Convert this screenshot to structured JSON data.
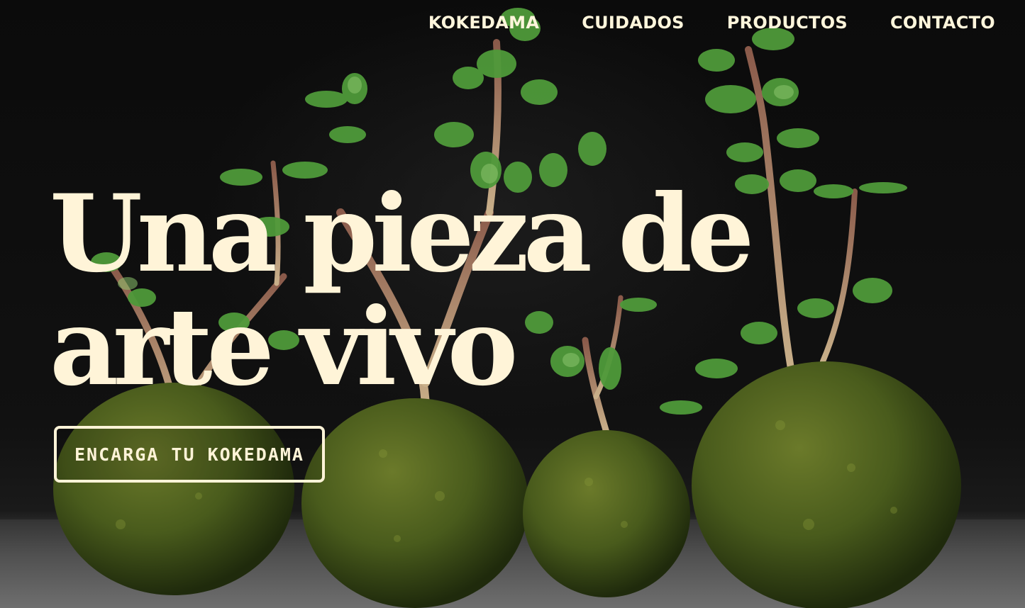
{
  "nav": {
    "items": [
      {
        "label": "KOKEDAMA"
      },
      {
        "label": "CUIDADOS"
      },
      {
        "label": "PRODUCTOS"
      },
      {
        "label": "CONTACTO"
      }
    ]
  },
  "hero": {
    "headline": "Una pieza de arte vivo",
    "cta_label": "ENCARGA TU KOKEDAMA",
    "background_image": "kokedama-plants-moss-balls"
  },
  "colors": {
    "text_cream": "#fff4d8",
    "background_dark": "#0b0b0b",
    "moss_green": "#4a5a1e",
    "leaf_green": "#4f9a3a"
  }
}
